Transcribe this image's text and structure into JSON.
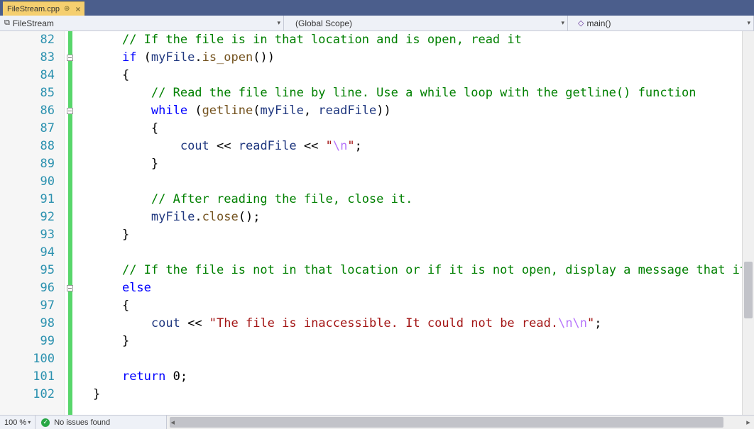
{
  "tab": {
    "filename": "FileStream.cpp",
    "pin": "⊕",
    "close": "×"
  },
  "nav": {
    "class_scope": "FileStream",
    "global_scope": "(Global Scope)",
    "member": "main()",
    "class_icon": "⧉"
  },
  "status": {
    "zoom": "100 %",
    "issues": "No issues found"
  },
  "code": [
    {
      "n": 82,
      "outline": "",
      "indent": 1,
      "tokens": [
        [
          "comment",
          "// If the file is in that location and is open, read it"
        ]
      ]
    },
    {
      "n": 83,
      "outline": "box",
      "indent": 1,
      "tokens": [
        [
          "kw",
          "if"
        ],
        [
          "text",
          " ("
        ],
        [
          "ident",
          "myFile"
        ],
        [
          "text",
          "."
        ],
        [
          "func",
          "is_open"
        ],
        [
          "text",
          "())"
        ]
      ]
    },
    {
      "n": 84,
      "outline": "",
      "indent": 1,
      "tokens": [
        [
          "text",
          "{"
        ]
      ]
    },
    {
      "n": 85,
      "outline": "",
      "indent": 2,
      "tokens": [
        [
          "comment",
          "// Read the file line by line. Use a while loop with the getline() function"
        ]
      ]
    },
    {
      "n": 86,
      "outline": "box",
      "indent": 2,
      "tokens": [
        [
          "kw",
          "while"
        ],
        [
          "text",
          " ("
        ],
        [
          "func",
          "getline"
        ],
        [
          "text",
          "("
        ],
        [
          "ident",
          "myFile"
        ],
        [
          "text",
          ", "
        ],
        [
          "ident",
          "readFile"
        ],
        [
          "text",
          "))"
        ]
      ]
    },
    {
      "n": 87,
      "outline": "",
      "indent": 2,
      "tokens": [
        [
          "text",
          "{"
        ]
      ]
    },
    {
      "n": 88,
      "outline": "",
      "indent": 3,
      "tokens": [
        [
          "ident",
          "cout"
        ],
        [
          "text",
          " << "
        ],
        [
          "ident",
          "readFile"
        ],
        [
          "text",
          " << "
        ],
        [
          "str",
          "\""
        ],
        [
          "esc",
          "\\n"
        ],
        [
          "str",
          "\""
        ],
        [
          "text",
          ";"
        ]
      ]
    },
    {
      "n": 89,
      "outline": "",
      "indent": 2,
      "tokens": [
        [
          "text",
          "}"
        ]
      ]
    },
    {
      "n": 90,
      "outline": "",
      "indent": 0,
      "tokens": []
    },
    {
      "n": 91,
      "outline": "",
      "indent": 2,
      "tokens": [
        [
          "comment",
          "// After reading the file, close it."
        ]
      ]
    },
    {
      "n": 92,
      "outline": "",
      "indent": 2,
      "tokens": [
        [
          "ident",
          "myFile"
        ],
        [
          "text",
          "."
        ],
        [
          "func",
          "close"
        ],
        [
          "text",
          "();"
        ]
      ]
    },
    {
      "n": 93,
      "outline": "",
      "indent": 1,
      "tokens": [
        [
          "text",
          "}"
        ]
      ]
    },
    {
      "n": 94,
      "outline": "",
      "indent": 0,
      "tokens": []
    },
    {
      "n": 95,
      "outline": "",
      "indent": 1,
      "tokens": [
        [
          "comment",
          "// If the file is not in that location or if it is not open, display a message that it is inaccessible"
        ]
      ]
    },
    {
      "n": 96,
      "outline": "box",
      "indent": 1,
      "tokens": [
        [
          "kw",
          "else"
        ]
      ]
    },
    {
      "n": 97,
      "outline": "",
      "indent": 1,
      "tokens": [
        [
          "text",
          "{"
        ]
      ]
    },
    {
      "n": 98,
      "outline": "",
      "indent": 2,
      "tokens": [
        [
          "ident",
          "cout"
        ],
        [
          "text",
          " << "
        ],
        [
          "str",
          "\"The file is inaccessible. It could not be read."
        ],
        [
          "esc",
          "\\n\\n"
        ],
        [
          "str",
          "\""
        ],
        [
          "text",
          ";"
        ]
      ]
    },
    {
      "n": 99,
      "outline": "",
      "indent": 1,
      "tokens": [
        [
          "text",
          "}"
        ]
      ]
    },
    {
      "n": 100,
      "outline": "",
      "indent": 0,
      "tokens": []
    },
    {
      "n": 101,
      "outline": "",
      "indent": 1,
      "tokens": [
        [
          "kw",
          "return"
        ],
        [
          "text",
          " 0;"
        ]
      ]
    },
    {
      "n": 102,
      "outline": "",
      "indent": 0,
      "tokens": [
        [
          "text",
          "}"
        ]
      ]
    }
  ]
}
